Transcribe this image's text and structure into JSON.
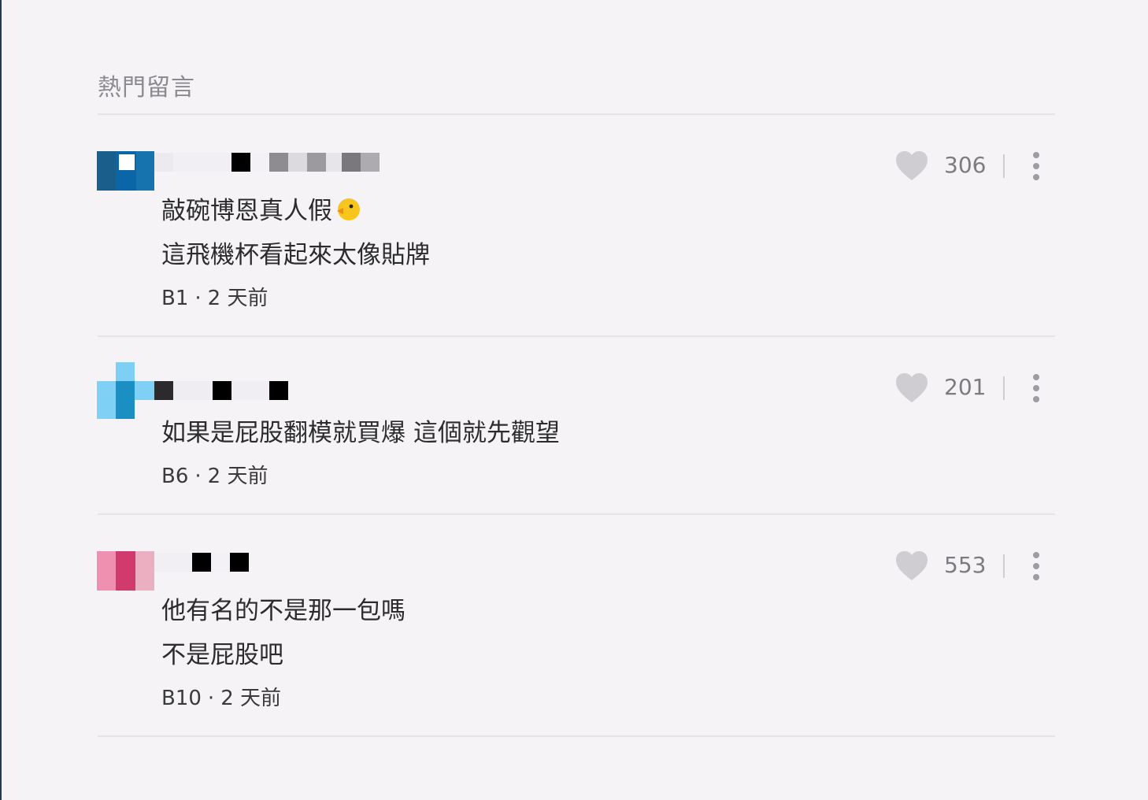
{
  "section": {
    "title": "熱門留言"
  },
  "comments": [
    {
      "lines": [
        "敲碗博恩真人假",
        "這飛機杯看起來太像貼牌"
      ],
      "floor": "B1",
      "time": "2 天前",
      "likes": "306",
      "has_emoji": true
    },
    {
      "lines": [
        "如果是屁股翻模就買爆 這個就先觀望"
      ],
      "floor": "B6",
      "time": "2 天前",
      "likes": "201",
      "has_emoji": false
    },
    {
      "lines": [
        "他有名的不是那一包嗎",
        "不是屁股吧"
      ],
      "floor": "B10",
      "time": "2 天前",
      "likes": "553",
      "has_emoji": false
    }
  ],
  "meta_separator": "·",
  "icons": {
    "like": "heart-icon",
    "more": "more-vertical-icon",
    "emoji": "chick-emoji-icon"
  },
  "colors": {
    "heart": "#cfcdd2",
    "text": "#2c2c2e",
    "muted": "#7c7c80"
  }
}
